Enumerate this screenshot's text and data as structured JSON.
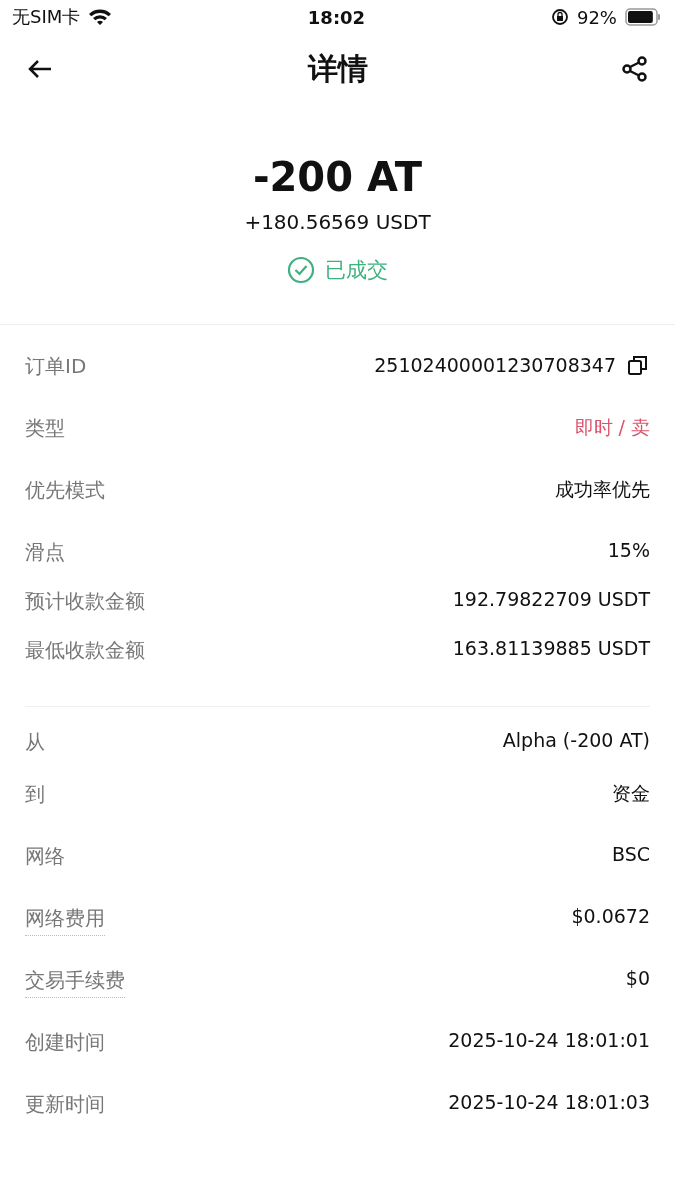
{
  "status_bar": {
    "carrier": "无SIM卡",
    "time": "18:02",
    "battery": "92%"
  },
  "header": {
    "title": "详情"
  },
  "summary": {
    "amount": "-200 AT",
    "received": "+180.56569 USDT",
    "status": "已成交",
    "done": true
  },
  "sections": [
    {
      "rows": [
        {
          "label": "订单ID",
          "value": "25102400001230708347",
          "kind": "copy",
          "dotted": false
        },
        {
          "label": "类型",
          "value": "即时 / 卖",
          "kind": "sell",
          "dotted": false
        },
        {
          "label": "优先模式",
          "value": "成功率优先",
          "kind": "plain",
          "dotted": false
        },
        {
          "label": "滑点",
          "value": "15%",
          "kind": "plain",
          "dotted": false
        },
        {
          "label": "预计收款金额",
          "value": "192.79822709 USDT",
          "kind": "plain",
          "dotted": false
        },
        {
          "label": "最低收款金额",
          "value": "163.81139885 USDT",
          "kind": "plain",
          "dotted": false
        }
      ]
    },
    {
      "rows": [
        {
          "label": "从",
          "value": "Alpha (-200 AT)",
          "kind": "plain",
          "dotted": false
        },
        {
          "label": "到",
          "value": "资金",
          "kind": "plain",
          "dotted": false
        },
        {
          "label": "网络",
          "value": "BSC",
          "kind": "plain",
          "dotted": false
        },
        {
          "label": "网络费用",
          "value": "$0.0672",
          "kind": "plain",
          "dotted": true
        },
        {
          "label": "交易手续费",
          "value": "$0",
          "kind": "plain",
          "dotted": true
        },
        {
          "label": "创建时间",
          "value": "2025-10-24 18:01:01",
          "kind": "plain",
          "dotted": false
        },
        {
          "label": "更新时间",
          "value": "2025-10-24 18:01:03",
          "kind": "plain",
          "dotted": false
        }
      ]
    }
  ]
}
